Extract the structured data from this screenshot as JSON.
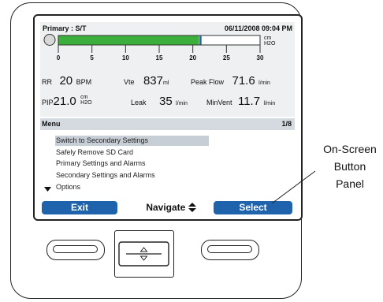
{
  "header": {
    "mode": "Primary : S/T",
    "datetime": "06/11/2008 09:04 PM"
  },
  "bar_graph": {
    "unit_top": "cm",
    "unit_bottom": "H2O",
    "tick_labels": [
      "0",
      "5",
      "10",
      "15",
      "20",
      "25",
      "30"
    ],
    "fill_value": 21,
    "max_value": 30
  },
  "measurements": {
    "rr": {
      "label": "RR",
      "value": "20",
      "unit": "BPM"
    },
    "vte": {
      "label": "Vte",
      "value": "837",
      "unit": "ml"
    },
    "peak": {
      "label": "Peak Flow",
      "value": "71.6",
      "unit": "l/min"
    },
    "pip": {
      "label": "PIP",
      "value": "21.0",
      "unit_top": "cm",
      "unit_bottom": "H2O"
    },
    "leak": {
      "label": "Leak",
      "value": "35",
      "unit": "l/min"
    },
    "minvent": {
      "label": "MinVent",
      "value": "11.7",
      "unit": "l/min"
    }
  },
  "menu": {
    "title": "Menu",
    "page": "1/8",
    "items": [
      "Switch to Secondary Settings",
      "Safely Remove SD Card",
      "Primary Settings and Alarms",
      "Secondary Settings and Alarms",
      "Options"
    ]
  },
  "softkeys": {
    "exit": "Exit",
    "navigate": "Navigate",
    "select": "Select"
  },
  "callout": {
    "line1": "On-Screen",
    "line2": "Button",
    "line3": "Panel"
  },
  "colors": {
    "accent": "#1f63ad",
    "graph_fill": "#3cae3c",
    "marker": "#1f63ad"
  }
}
